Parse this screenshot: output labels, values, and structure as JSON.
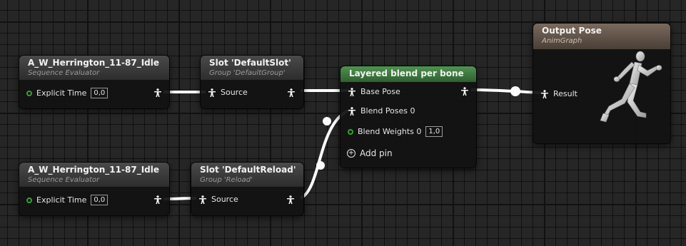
{
  "nodes": {
    "idle_top": {
      "title": "A_W_Herrington_11-87_Idle",
      "subtitle": "Sequence Evaluator",
      "pin_label": "Explicit Time",
      "pin_value": "0,0"
    },
    "slot_default": {
      "title": "Slot 'DefaultSlot'",
      "subtitle": "Group 'DefaultGroup'",
      "pin_label": "Source"
    },
    "layered": {
      "title": "Layered blend per bone",
      "base_pose": "Base Pose",
      "blend_poses": "Blend Poses 0",
      "blend_weights": "Blend Weights 0",
      "blend_weights_value": "1,0",
      "add_pin": "Add pin"
    },
    "output": {
      "title": "Output Pose",
      "subtitle": "AnimGraph",
      "pin_label": "Result"
    },
    "idle_bottom": {
      "title": "A_W_Herrington_11-87_Idle",
      "subtitle": "Sequence Evaluator",
      "pin_label": "Explicit Time",
      "pin_value": "0,0"
    },
    "slot_reload": {
      "title": "Slot 'DefaultReload'",
      "subtitle": "Group 'Reload'",
      "pin_label": "Source"
    }
  },
  "colors": {
    "grid_bg": "#262626",
    "wire": "#ffffff",
    "float_pin": "#2ea52e",
    "layered_header": "#3f7a3f",
    "output_header": "#5e5046"
  },
  "icons": [
    "pose-pin-icon",
    "float-pin-icon",
    "add-pin-icon",
    "mannequin-icon"
  ]
}
